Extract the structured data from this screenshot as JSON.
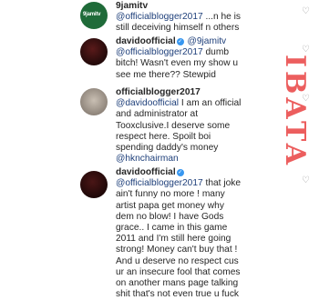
{
  "comments": [
    {
      "username": "9jamitv",
      "lines": [
        {
          "mention": "@officialblogger2017",
          "text": " ...n he is"
        },
        {
          "text": "still deceiving himself n others"
        }
      ]
    },
    {
      "username": "davidoofficial",
      "verified": true,
      "line0_mention": "@9jamitv",
      "lines": [
        {
          "mention": "@officialblogger2017",
          "text": " dumb"
        },
        {
          "text": "bitch! Wasn't even my show u"
        },
        {
          "text": "see me there?? Stewpid"
        }
      ]
    },
    {
      "username": "officialblogger2017",
      "lines": [
        {
          "mention": "@davidoofficial",
          "text": " I am an official"
        },
        {
          "text": "and administrator at"
        },
        {
          "text": "Tooxclusive.I deserve some"
        },
        {
          "text": "respect here. Spoilt boi"
        },
        {
          "text": "spending daddy's money"
        },
        {
          "mention": "@hknchairman",
          "text": ""
        }
      ]
    },
    {
      "username": "davidoofficial",
      "verified": true,
      "lines": [
        {
          "mention": "@officialblogger2017",
          "text": " that joke"
        },
        {
          "text": "ain't funny no more ! many"
        },
        {
          "text": "artist papa get money why"
        },
        {
          "text": "dem no blow! I have Gods"
        },
        {
          "text": "grace.. I came in this game"
        },
        {
          "text": "2011 and I'm still here going"
        },
        {
          "text": "strong! Money can't buy that !"
        },
        {
          "text": "And u deserve no respect cus"
        },
        {
          "text": "ur an insecure fool that comes"
        },
        {
          "text": "on another mans page talking"
        },
        {
          "text": "shit that's not even true u fuck"
        }
      ]
    }
  ],
  "avatar_labels": {
    "first": "9jamitv"
  },
  "watermark": "IBATA",
  "heart_icon": "heart-icon",
  "colors": {
    "mention": "#1e3f7a",
    "verified": "#3897f0",
    "watermark": "#e62828"
  }
}
